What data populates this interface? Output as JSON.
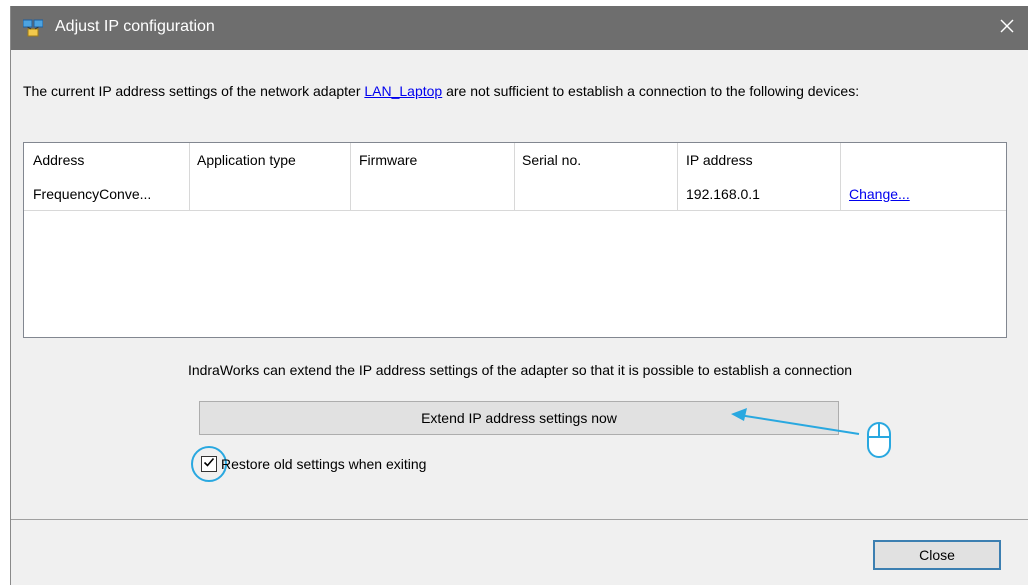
{
  "window": {
    "title": "Adjust IP configuration",
    "icon": "network-adapter-icon",
    "close_glyph": "✕"
  },
  "intro": {
    "text_before": "The current IP address settings of the network adapter ",
    "adapter_link": "LAN_Laptop",
    "text_after": " are not sufficient to establish a connection to the following devices:"
  },
  "table": {
    "columns": [
      "Address",
      "Application type",
      "Firmware",
      "Serial no.",
      "IP address",
      ""
    ],
    "rows": [
      {
        "address": "FrequencyConve...",
        "application_type": "",
        "firmware": "",
        "serial_no": "",
        "ip_address": "192.168.0.1",
        "action": "Change..."
      }
    ]
  },
  "info_text": "IndraWorks can extend the IP address settings of the adapter so that it is possible to establish a connection",
  "extend_button": "Extend IP address settings now",
  "restore_checkbox": {
    "label": "Restore old settings when exiting",
    "checked": true
  },
  "close_button": "Close",
  "colors": {
    "titlebar": "#6e6e6e",
    "link": "#0000ee",
    "highlight": "#29a8e0",
    "dialog_bg": "#f0f0f0"
  },
  "annotations": {
    "mouse_icon": "mouse-icon",
    "arrow": "pointer-arrow-icon"
  }
}
